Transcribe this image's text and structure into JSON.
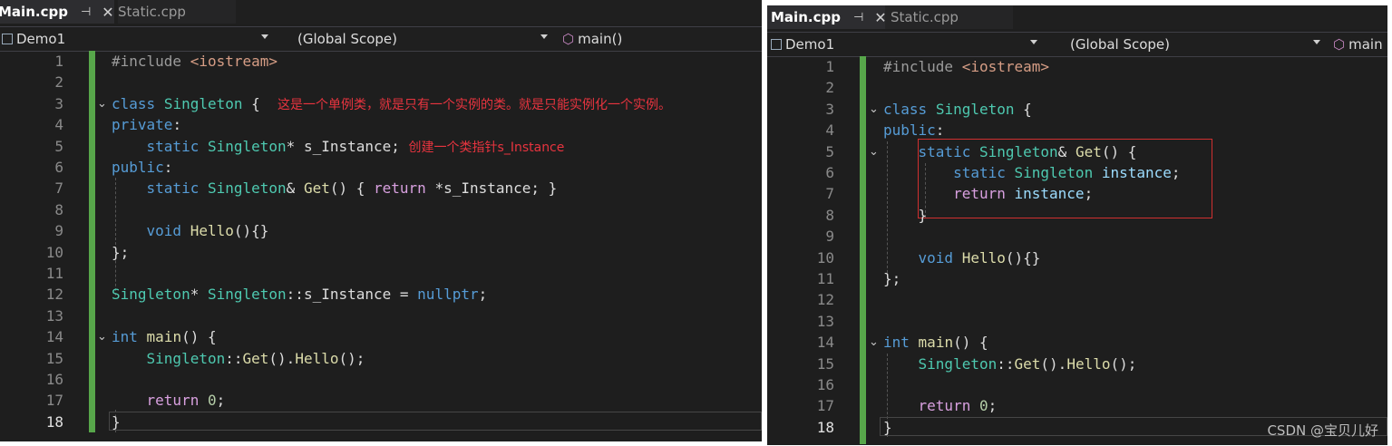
{
  "left": {
    "tabs": [
      {
        "label": "Main.cpp",
        "active": true
      },
      {
        "label": "Static.cpp",
        "active": false
      }
    ],
    "nav": {
      "project": "Demo1",
      "scope": "(Global Scope)",
      "member": "main()"
    },
    "code": {
      "line_numbers": [
        "1",
        "2",
        "3",
        "4",
        "5",
        "6",
        "7",
        "8",
        "9",
        "10",
        "11",
        "12",
        "13",
        "14",
        "15",
        "16",
        "17",
        "18"
      ],
      "annotation_line3": "这是一个单例类，就是只有一个实例的类。就是只能实例化一个实例。",
      "annotation_line5": "创建一个类指针s_Instance"
    }
  },
  "right": {
    "tabs": [
      {
        "label": "Main.cpp",
        "active": true
      },
      {
        "label": "Static.cpp",
        "active": false
      }
    ],
    "nav": {
      "project": "Demo1",
      "scope": "(Global Scope)",
      "member": "main"
    },
    "code": {
      "line_numbers": [
        "1",
        "2",
        "3",
        "4",
        "5",
        "6",
        "7",
        "8",
        "9",
        "10",
        "11",
        "12",
        "13",
        "14",
        "15",
        "16",
        "17",
        "18"
      ]
    },
    "watermark": "CSDN @宝贝儿好"
  },
  "icons": [
    "pin-icon",
    "close-icon",
    "project-icon",
    "member-icon",
    "dropdown-caret-icon",
    "fold-chevron-icon"
  ],
  "colors": {
    "editor_bg": "#1e1e1e",
    "keyword": "#569cd6",
    "type": "#4ec9b0",
    "function": "#dcdcaa",
    "control": "#d8a0df",
    "annotation": "#e8343f",
    "change_bar": "#57a64a"
  }
}
